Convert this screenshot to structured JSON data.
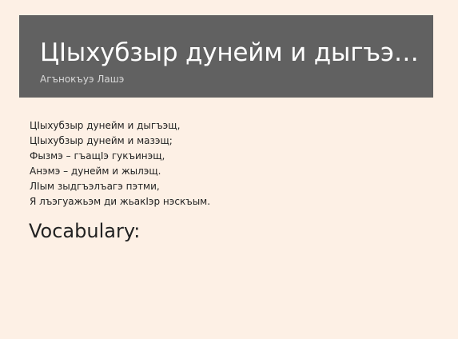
{
  "header": {
    "title": "ЦIыхубзыр дунейм и дыгъэщ…",
    "author": "Агънокъуэ Лашэ"
  },
  "poem": {
    "lines": [
      "ЦIыхубзыр дунейм и дыгъэщ,",
      "ЦIыхубзыр дунейм и мазэщ;",
      "Фызмэ – гъащIэ гукъинэщ,",
      "Анэмэ – дунейм и жылэщ.",
      "ЛIым зыдгъэлъагэ пэтми,",
      "Я лъэгуажьэм ди жьакIэр нэскъым."
    ]
  },
  "vocabulary": {
    "heading": "Vocabulary:"
  }
}
